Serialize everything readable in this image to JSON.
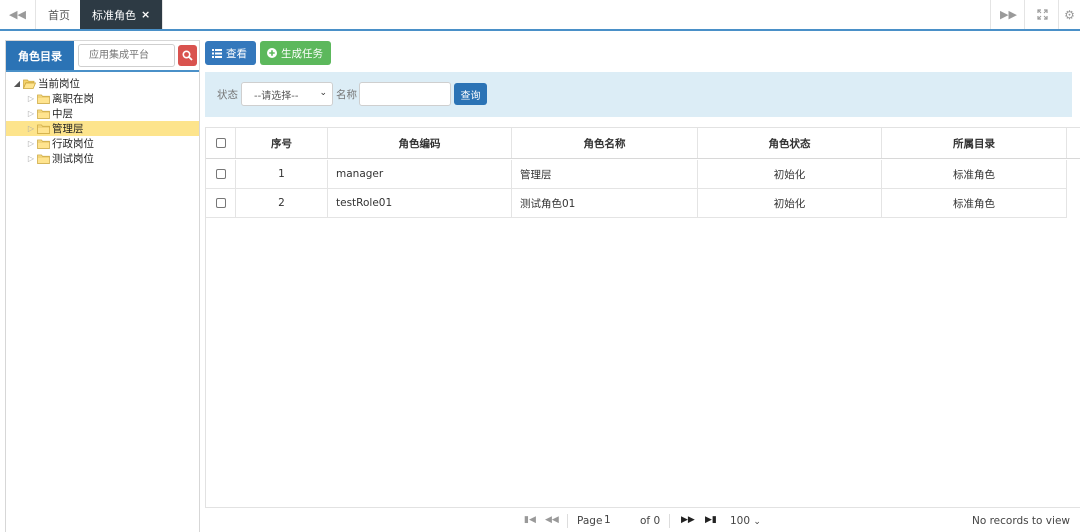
{
  "tabs": {
    "home": "首页",
    "active": "标准角色",
    "close_glyph": "×"
  },
  "left": {
    "title": "角色目录",
    "search_placeholder": "应用集成平台",
    "tree": [
      {
        "label": "当前岗位",
        "level": 0,
        "expanded": true,
        "selected": false
      },
      {
        "label": "离职在岗",
        "level": 1,
        "expanded": false,
        "selected": false
      },
      {
        "label": "中层",
        "level": 1,
        "expanded": false,
        "selected": false
      },
      {
        "label": "管理层",
        "level": 1,
        "expanded": false,
        "selected": true
      },
      {
        "label": "行政岗位",
        "level": 1,
        "expanded": false,
        "selected": false
      },
      {
        "label": "测试岗位",
        "level": 1,
        "expanded": false,
        "selected": false
      }
    ]
  },
  "toolbar": {
    "view_label": "查看",
    "generate_label": "生成任务"
  },
  "search": {
    "status_label": "状态",
    "status_selected": "--请选择--",
    "name_label": "名称",
    "query_label": "查询"
  },
  "grid": {
    "headers": [
      "序号",
      "角色编码",
      "角色名称",
      "角色状态",
      "所属目录"
    ],
    "rows": [
      {
        "no": "1",
        "code": "manager",
        "name": "管理层",
        "status": "初始化",
        "dir": "标准角色"
      },
      {
        "no": "2",
        "code": "testRole01",
        "name": "测试角色01",
        "status": "初始化",
        "dir": "标准角色"
      }
    ]
  },
  "pager": {
    "page_label": "Page",
    "page_value": "1",
    "of_label": "of 0",
    "page_size": "100",
    "records": "No records to view"
  },
  "colors": {
    "primary": "#2b73b5",
    "success": "#5cb85c",
    "danger": "#d9534f",
    "selected_row": "#fde48c",
    "search_bg": "#dcedf6",
    "active_tab": "#2d3a44"
  }
}
